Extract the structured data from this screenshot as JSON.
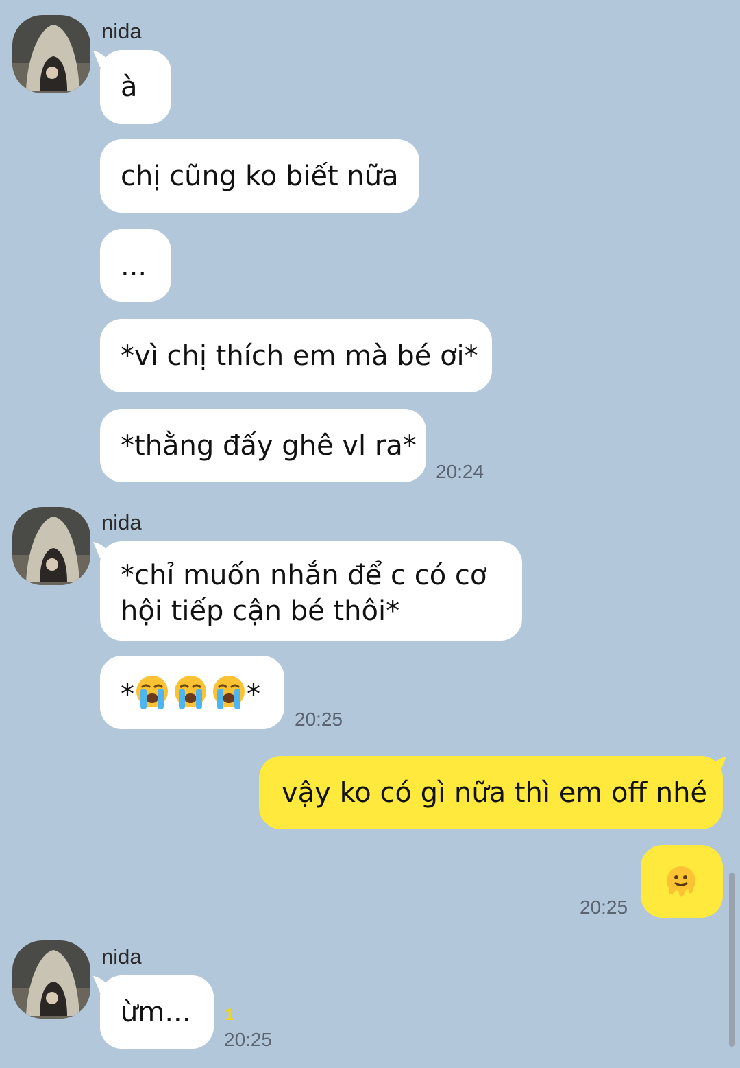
{
  "conversation": {
    "groups": [
      {
        "sender": "nida",
        "messages": [
          "à",
          "chị cũng ko biết nữa",
          "...",
          "*vì chị thích em mà bé ơi*",
          "*thằng đấy ghê vl ra*"
        ],
        "time": "20:24"
      },
      {
        "sender": "nida",
        "messages": [
          "*chỉ muốn nhắn để c có cơ hội tiếp cận bé thôi*",
          "*",
          "*"
        ],
        "time": "20:25"
      },
      {
        "sender": "me",
        "messages": [
          "vậy ko có gì nữa thì em off nhé"
        ],
        "time": "20:25"
      },
      {
        "sender": "nida",
        "messages": [
          "ừm..."
        ],
        "unread": "1",
        "time": "20:25"
      }
    ]
  },
  "icons": {
    "avatar": "hooded-figure-avatar",
    "crying": "loudly-crying-face-emoji",
    "melting": "melting-face-emoji"
  },
  "colors": {
    "background": "#b2c7da",
    "incoming_bubble": "#ffffff",
    "outgoing_bubble": "#fee93c",
    "unread_count": "#f1d51e"
  }
}
